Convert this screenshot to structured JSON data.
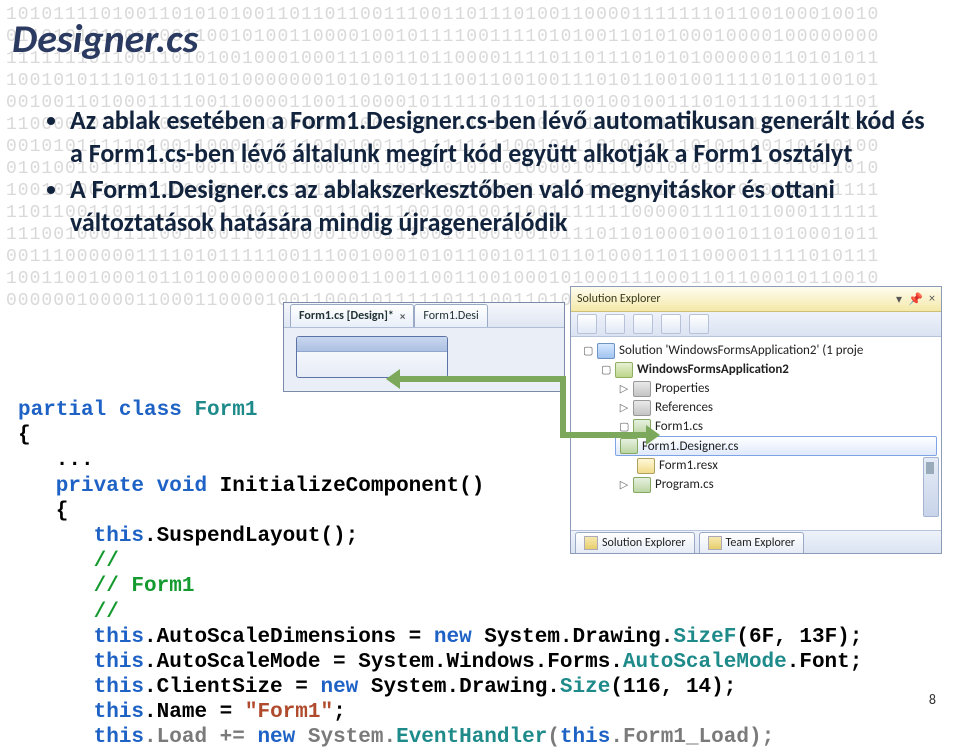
{
  "title": "Designer.cs",
  "bullets": [
    "Az ablak esetében a Form1.Designer.cs-ben lévő automatikusan generált kód és a Form1.cs-ben lévő általunk megírt kód együtt alkotják a Form1 osztályt",
    "A Form1.Designer.cs az ablakszerkesztőben való megnyitáskor és ottani változtatások hatására mindig újragenerálódik"
  ],
  "page_number": "8",
  "vs": {
    "tab_active": "Form1.cs [Design]*",
    "tab_close": "×",
    "tab_other": "Form1.Desi"
  },
  "solution_explorer": {
    "caption": "Solution Explorer",
    "pin_icon": "📌",
    "close_icon": "×",
    "nodes": {
      "solution": "Solution 'WindowsFormsApplication2' (1 proje",
      "project": "WindowsFormsApplication2",
      "properties": "Properties",
      "references": "References",
      "form_cs": "Form1.cs",
      "form_designer": "Form1.Designer.cs",
      "form_resx": "Form1.resx",
      "program": "Program.cs"
    },
    "footer_tab1": "Solution Explorer",
    "footer_tab2": "Team Explorer"
  },
  "code": {
    "l1a": "partial",
    "l1b": " class ",
    "l1c": "Form1",
    "l2": "{",
    "l3": "   ...",
    "l4a": "   private",
    "l4b": " void",
    "l4c": " InitializeComponent()",
    "l5": "   {",
    "l6a": "      this",
    "l6b": ".SuspendLayout();",
    "l7": "      //",
    "l8": "      // Form1",
    "l9": "      //",
    "l10a": "      this",
    "l10b": ".AutoScaleDimensions = ",
    "l10c": "new",
    "l10d": " System.Drawing.",
    "l10e": "SizeF",
    "l10f": "(6F, 13F);",
    "l11a": "      this",
    "l11b": ".AutoScaleMode = System.Windows.Forms.",
    "l11c": "AutoScaleMode",
    "l11d": ".Font;",
    "l12a": "      this",
    "l12b": ".ClientSize = ",
    "l12c": "new",
    "l12d": " System.Drawing.",
    "l12e": "Size",
    "l12f": "(116, 14);",
    "l13a": "      this",
    "l13b": ".Name = ",
    "l13c": "\"Form1\"",
    "l13d": ";",
    "l14a": "      this",
    "l14b": ".Load += ",
    "l14c": "new",
    "l14d": " System.",
    "l14e": "EventHandler",
    "l14f": "(",
    "l14g": "this",
    "l14h": ".Form1_Load);"
  },
  "binary_bg": "10101111010011010101001101101100111001101110100110000111111101100100010010\n01101010100100011001010011000010010111100111101010011010100010000100000000\n11111110110011010100100010001110011011000011110110111010101000000110101011\n10010101110101110101000000010101010111001100100111010110010011110101100101\n00100110100011110011000011001100001011111011011100100100111010111100111101\n11000010110100001101000000010100000111111111100101110100101101011001101100\n00101011111010011000101111010100111111111110010111010010110101100110110100\n01010010111111010011001011001101101010101101000010111001010101111111011010\n10010100111001000001110111101011000010110000110111101101011001010000111111\n11011001101111111011001011011101110010010011001111111000001111011000111111\n11100100011110011001101100001000111001010010010111011010001001011010001011\n00111000000111101011111001110010001010110010110110100011011000011111010111\n10011001000101101000000001000011001100110010001010001110001101100010110010\n00000010000110001100001001100010111110111001101001011001000100111101000101"
}
